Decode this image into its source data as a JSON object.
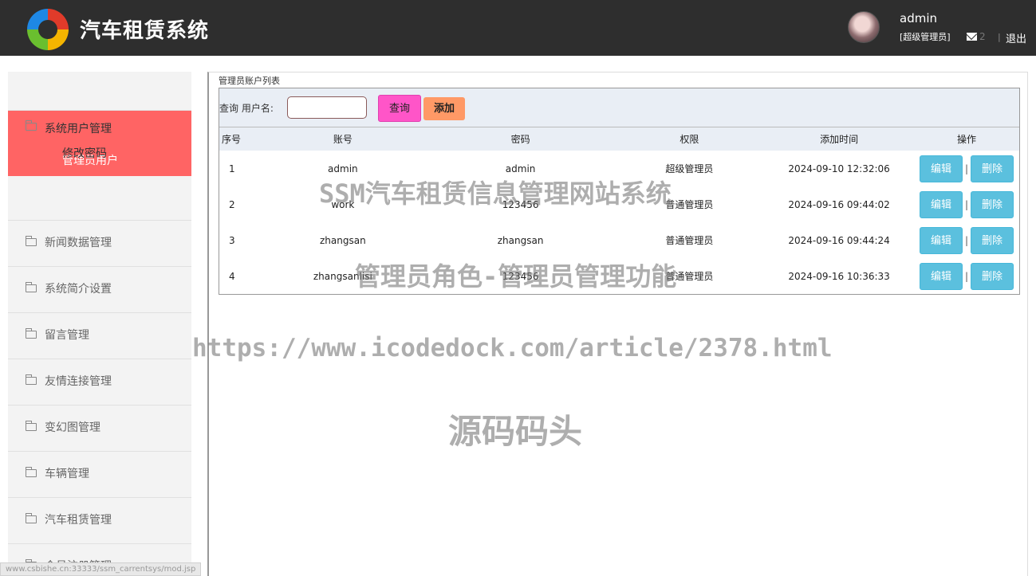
{
  "header": {
    "app_title": "汽车租赁系统",
    "username": "admin",
    "role": "[超级管理员]",
    "mail_count": "2",
    "separator": "|",
    "logout": "退出"
  },
  "sidebar": {
    "active_group": "系统用户管理",
    "active_sub_items": [
      "管理员用户",
      "修改密码"
    ],
    "groups": [
      "新闻数据管理",
      "系统简介设置",
      "留言管理",
      "友情连接管理",
      "变幻图管理",
      "车辆管理",
      "汽车租赁管理",
      "会员注册管理"
    ]
  },
  "status_url": "www.csbishe.cn:33333/ssm_carrentsys/mod.jsp",
  "main": {
    "list_title": "管理员账户列表",
    "query_label": "查询 用户名:",
    "query_value": "",
    "query_button": "查询",
    "add_button": "添加",
    "columns": [
      "序号",
      "账号",
      "密码",
      "权限",
      "添加时间",
      "操作"
    ],
    "rows": [
      {
        "idx": "1",
        "account": "admin",
        "password": "admin",
        "permission": "超级管理员",
        "added": "2024-09-10 12:32:06"
      },
      {
        "idx": "2",
        "account": "work",
        "password": "123456",
        "permission": "普通管理员",
        "added": "2024-09-16 09:44:02"
      },
      {
        "idx": "3",
        "account": "zhangsan",
        "password": "zhangsan",
        "permission": "普通管理员",
        "added": "2024-09-16 09:44:24"
      },
      {
        "idx": "4",
        "account": "zhangsanlisi",
        "password": "123456",
        "permission": "普通管理员",
        "added": "2024-09-16 10:36:33"
      }
    ],
    "edit_label": "编辑",
    "delete_label": "删除",
    "op_separator": "|"
  },
  "watermarks": [
    "SSM汽车租赁信息管理网站系统",
    "管理员角色-管理员管理功能",
    "https://www.icodedock.com/article/2378.html",
    "源码码头"
  ],
  "colors": {
    "header_bg": "#2e2e2e",
    "active_menu": "#ff6464",
    "query_button": "#ff55c8",
    "add_button": "#ff9966",
    "action_button": "#5bc0de"
  }
}
